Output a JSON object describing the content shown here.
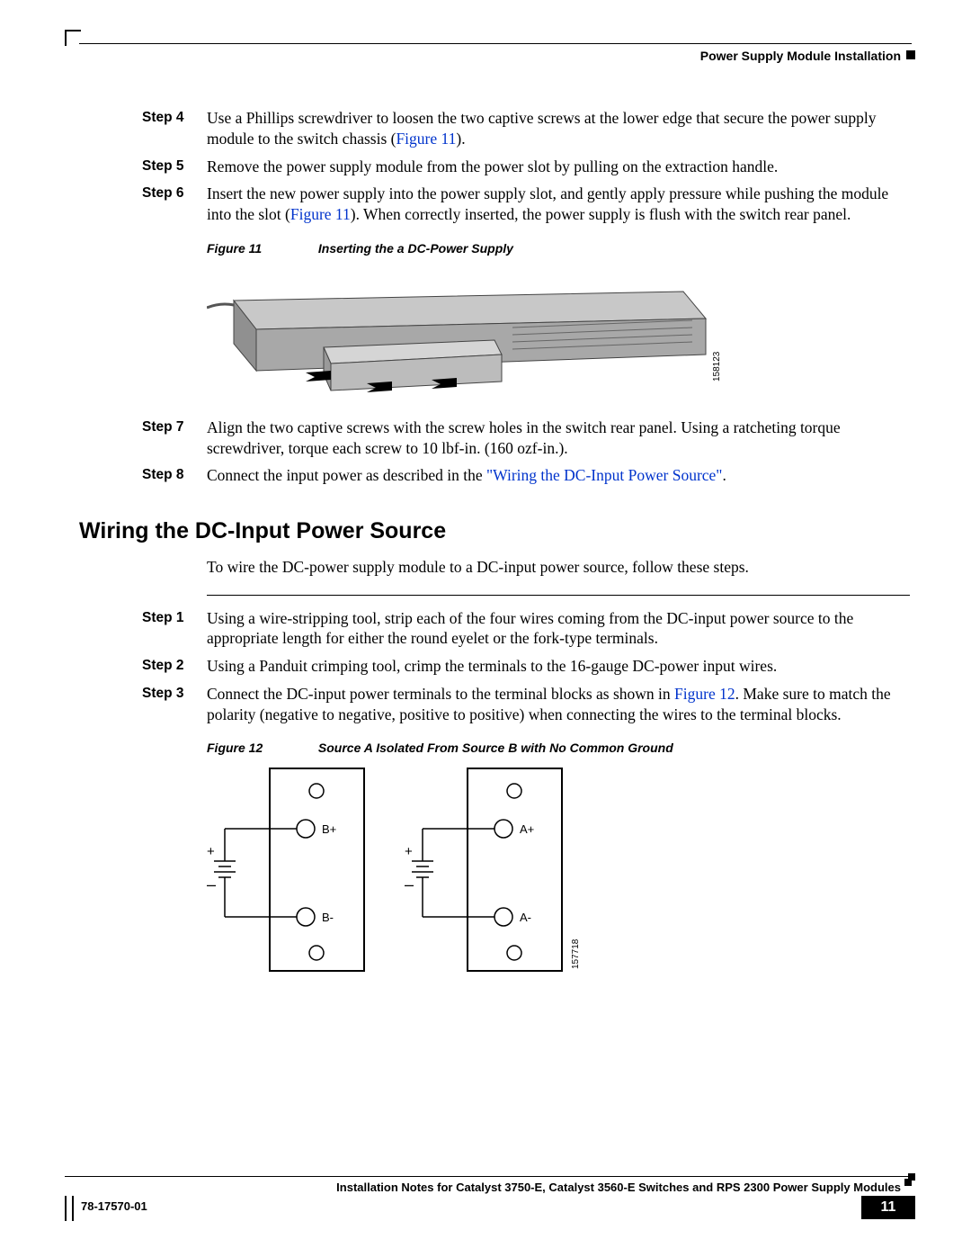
{
  "header": {
    "chapter": "Power Supply Module Installation"
  },
  "steps_a": [
    {
      "label": "Step 4",
      "text_a": "Use a Phillips screwdriver to loosen the two captive screws at the lower edge that secure the power supply module to the switch chassis (",
      "link": "Figure 11",
      "text_b": ")."
    },
    {
      "label": "Step 5",
      "text_a": "Remove the power supply module from the power slot by pulling on the extraction handle.",
      "link": "",
      "text_b": ""
    },
    {
      "label": "Step 6",
      "text_a": "Insert the new power supply into the power supply slot, and gently apply pressure while pushing the module into the slot (",
      "link": "Figure 11",
      "text_b": "). When correctly inserted, the power supply is flush with the switch rear panel."
    }
  ],
  "figure11": {
    "label": "Figure 11",
    "caption": "Inserting the a DC-Power Supply",
    "id": "158123"
  },
  "steps_b": [
    {
      "label": "Step 7",
      "text_a": "Align the two captive screws with the screw holes in the switch rear panel. Using a ratcheting torque screwdriver, torque each screw to 10 lbf-in. (160 ozf-in.).",
      "link": "",
      "text_b": ""
    },
    {
      "label": "Step 8",
      "text_a": "Connect the input power as described in the ",
      "link": "\"Wiring the DC-Input Power Source\"",
      "text_b": "."
    }
  ],
  "section": {
    "heading": "Wiring the DC-Input Power Source",
    "intro": "To wire the DC-power supply module to a DC-input power source, follow these steps."
  },
  "steps_c": [
    {
      "label": "Step 1",
      "text_a": "Using a wire-stripping tool, strip each of the four wires coming from the DC-input power source to the appropriate length for either the round eyelet or the fork-type terminals.",
      "link": "",
      "text_b": ""
    },
    {
      "label": "Step 2",
      "text_a": "Using a Panduit crimping tool, crimp the terminals to the 16-gauge DC-power input wires.",
      "link": "",
      "text_b": ""
    },
    {
      "label": "Step 3",
      "text_a": "Connect the DC-input power terminals to the terminal blocks as shown in ",
      "link": "Figure 12",
      "text_b": ". Make sure to match the polarity (negative to negative, positive to positive) when connecting the wires to the terminal blocks."
    }
  ],
  "figure12": {
    "label": "Figure 12",
    "caption": "Source A Isolated From Source B with No Common Ground",
    "id": "157718",
    "b_plus": "B+",
    "b_minus": "B-",
    "a_plus": "A+",
    "a_minus": "A-",
    "plus": "+",
    "minus": "–"
  },
  "footer": {
    "doc_title": "Installation Notes for Catalyst 3750-E, Catalyst 3560-E Switches and RPS 2300 Power Supply Modules",
    "doc_num": "78-17570-01",
    "page": "11"
  }
}
